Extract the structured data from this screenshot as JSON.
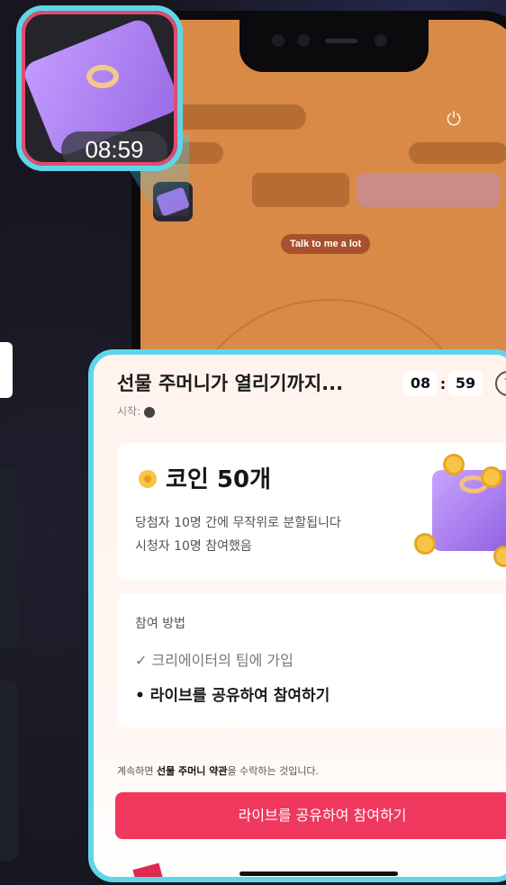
{
  "phone_screen": {
    "bubble_text": "Talk to me a lot",
    "power_icon": "power-icon"
  },
  "zoom_thumbnail": {
    "timer": "08:59"
  },
  "popup": {
    "title": "선물 주머니가 열리기까지...",
    "timer_minutes": "08",
    "timer_separator": ":",
    "timer_seconds": "59",
    "help_icon": "?",
    "starter_label": "시작:",
    "reward": {
      "title": "코인 50개",
      "line1": "당첨자 10명 간에 무작위로 분할됩니다",
      "line2": "시청자 10명 참여했음"
    },
    "how_to": {
      "title": "참여 방법",
      "step1": "✓ 크리에이터의 팀에 가입",
      "step2": "• 라이브를 공유하여 참여하기"
    },
    "terms_prefix": "계속하면 ",
    "terms_bold": "선물 주머니 약관",
    "terms_suffix": "을 수락하는 것입니다.",
    "cta_label": "라이브를 공유하여 참여하기"
  },
  "colors": {
    "accent": "#f0385e",
    "highlight_border": "#5fd6e8",
    "phone_screen_bg": "#d98a46"
  }
}
